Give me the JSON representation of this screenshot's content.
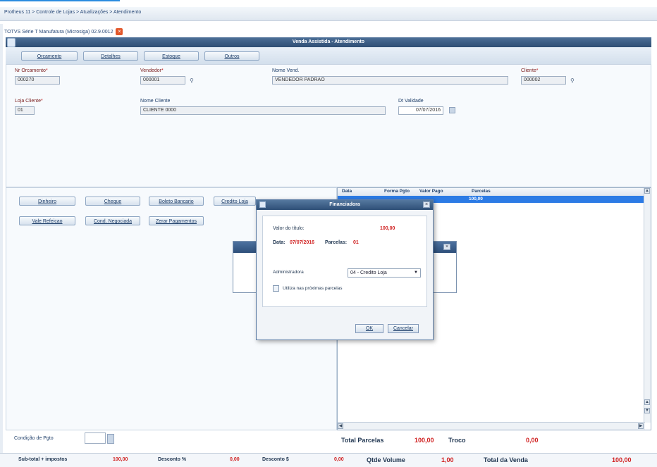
{
  "breadcrumb": "Protheus 11 > Controle de Lojas > Atualizações > Atendimento",
  "subtitle": "TOTVS Série T Manufatura (Microsiga) 02.9.0012",
  "window_title": "Venda Assistida - Atendimento",
  "tabs": [
    "Orcamento",
    "Detalhes",
    "Estoque",
    "Outros"
  ],
  "form": {
    "orcamento": {
      "label": "Nr Orcamento",
      "value": "000270"
    },
    "vendedor": {
      "label": "Vendedor",
      "value": "000001"
    },
    "nome_vend": {
      "label": "Nome Vend.",
      "value": "VENDEDOR PADRAO"
    },
    "cliente": {
      "label": "Cliente",
      "value": "000002"
    },
    "loja_cliente": {
      "label": "Loja Cliente",
      "value": "01"
    },
    "nome_cliente": {
      "label": "Nome Cliente",
      "value": "CLIENTE 0000"
    },
    "dt_validade": {
      "label": "Dt Validade",
      "value": "07/07/2016"
    }
  },
  "payment_buttons": [
    "Dinheiro",
    "Cheque",
    "Boleto Bancario",
    "Credito Loja",
    "Vale Refeicao",
    "Cond. Negociada",
    "Zerar Pagamentos"
  ],
  "grid": {
    "headers": [
      "Data",
      "Forma Pgto",
      "Valor Pago",
      "Parcelas"
    ],
    "selected_value": "100,00"
  },
  "dialog": {
    "title": "Financiadora",
    "valor_label": "Valor do título:",
    "valor": "100,00",
    "data_label": "Data:",
    "data": "07/07/2016",
    "parcelas_label": "Parcelas:",
    "parcelas": "01",
    "admin_label": "Administradora",
    "admin_value": "04 - Credito Loja",
    "checkbox_label": "Utiliza nas próximas parcelas",
    "ok": "OK",
    "cancel": "Cancelar"
  },
  "condicao_label": "Condição de Pgto",
  "totals": {
    "total_parcelas_label": "Total Parcelas",
    "total_parcelas": "100,00",
    "troco_label": "Troco",
    "troco": "0,00"
  },
  "footer": {
    "subtotal_label": "Sub-total + impostos",
    "subtotal": "100,00",
    "desconto_pct_label": "Desconto %",
    "desconto_pct": "0,00",
    "desconto_val_label": "Desconto $",
    "desconto_val": "0,00",
    "qtde_label": "Qtde Volume",
    "qtde": "1,00",
    "total_label": "Total da Venda",
    "total": "100,00"
  }
}
